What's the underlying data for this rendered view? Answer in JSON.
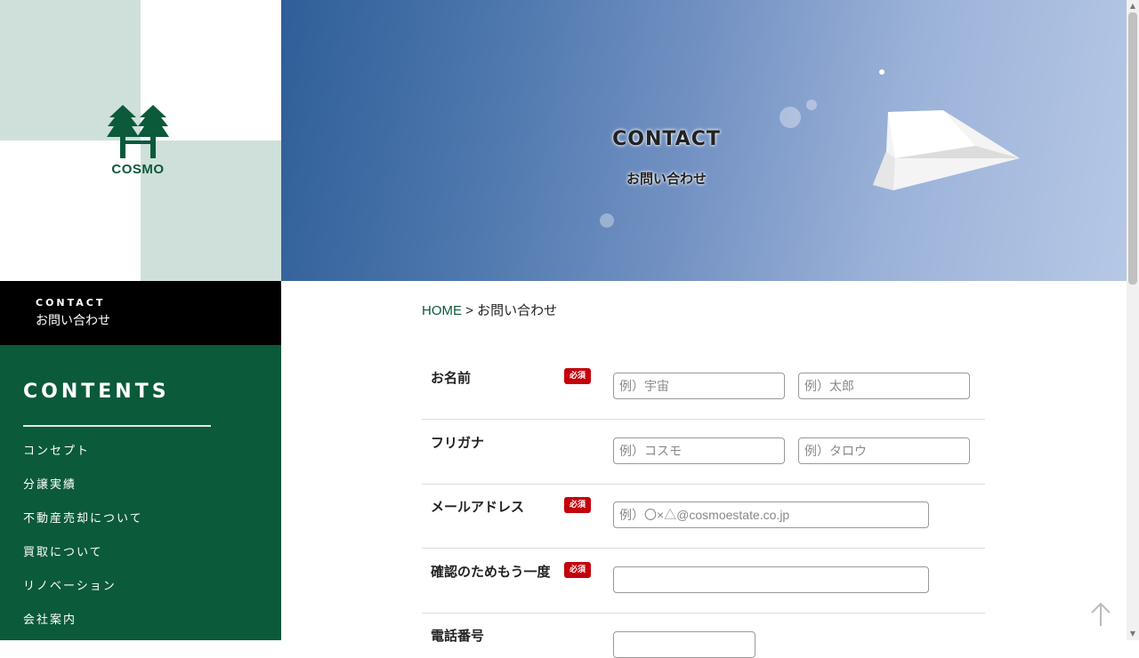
{
  "logo": {
    "text": "COSMO"
  },
  "current_page": {
    "en": "CONTACT",
    "jp": "お問い合わせ"
  },
  "sidebar": {
    "title": "CONTENTS",
    "items": [
      {
        "label": "コンセプト"
      },
      {
        "label": "分譲実績"
      },
      {
        "label": "不動産売却について"
      },
      {
        "label": "買取について"
      },
      {
        "label": "リノベーション"
      },
      {
        "label": "会社案内"
      }
    ]
  },
  "hero": {
    "title": "CONTACT",
    "subtitle": "お問い合わせ"
  },
  "breadcrumb": {
    "home": "HOME",
    "separator": " > ",
    "current": "お問い合わせ"
  },
  "form": {
    "required_badge": "必須",
    "rows": [
      {
        "label": "お名前",
        "required": true,
        "placeholders": [
          "例）宇宙",
          "例）太郎"
        ]
      },
      {
        "label": "フリガナ",
        "required": false,
        "placeholders": [
          "例）コスモ",
          "例）タロウ"
        ]
      },
      {
        "label": "メールアドレス",
        "required": true,
        "placeholders": [
          "例）〇×△@cosmoestate.co.jp"
        ]
      },
      {
        "label": "確認のためもう一度",
        "required": true,
        "placeholders": [
          ""
        ]
      },
      {
        "label": "電話番号",
        "required": false,
        "placeholders": [
          ""
        ]
      }
    ]
  },
  "colors": {
    "brand_green": "#0b5a3a",
    "required_red": "#c4000b",
    "logo_bg_tint": "#cfe0db"
  },
  "icons": {
    "back_to_top": "arrow-up-icon",
    "logo": "trees-logo-icon"
  }
}
